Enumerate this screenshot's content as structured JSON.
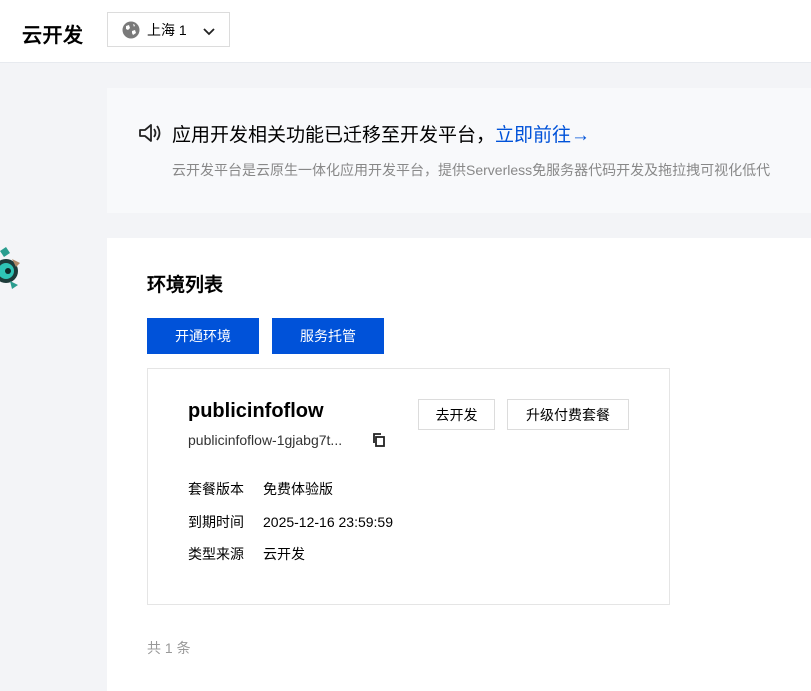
{
  "app": {
    "title": "云开发"
  },
  "region": {
    "label": "上海 1",
    "icon": "globe-icon"
  },
  "notice": {
    "headline": "应用开发相关功能已迁移至开发平台，",
    "link": "立即前往→",
    "description": "云开发平台是云原生一体化应用开发平台，提供Serverless免服务器代码开发及拖拉拽可视化低代"
  },
  "env_list": {
    "title": "环境列表",
    "open_env_label": "开通环境",
    "service_hosting_label": "服务托管",
    "env": {
      "name": "publicinfoflow",
      "id": "publicinfoflow-1gjabg7t...",
      "go_dev_label": "去开发",
      "upgrade_label": "升级付费套餐",
      "info": [
        {
          "key": "套餐版本",
          "value": "免费体验版"
        },
        {
          "key": "到期时间",
          "value": "2025-12-16 23:59:59"
        },
        {
          "key": "类型来源",
          "value": "云开发"
        }
      ]
    },
    "total": "共 1 条"
  },
  "colors": {
    "primary": "#0052d9",
    "link": "#0052d9",
    "muted": "#999999"
  }
}
